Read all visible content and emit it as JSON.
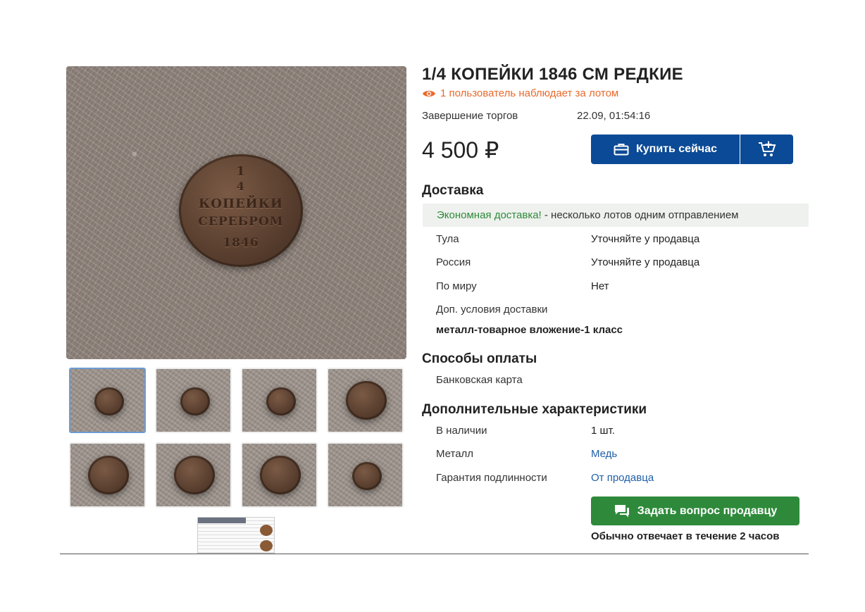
{
  "lot": {
    "title": "1/4 КОПЕЙКИ 1846 СМ РЕДКИЕ",
    "watchers": "1 пользователь наблюдает за лотом",
    "end_label": "Завершение торгов",
    "end_value": "22.09, 01:54:16",
    "price": "4 500 ₽",
    "buy_label": "Купить сейчас"
  },
  "coin_legend": {
    "fraction": "1",
    "denom": "4",
    "line1": "КОПЕЙКИ",
    "line2": "СЕРЕБРОМ",
    "year": "1846"
  },
  "delivery": {
    "heading": "Доставка",
    "econ_highlight": "Экономная доставка!",
    "econ_rest": " - несколько лотов одним отправлением",
    "rows": [
      {
        "label": "Тула",
        "value": "Уточняйте у продавца"
      },
      {
        "label": "Россия",
        "value": "Уточняйте у продавца"
      },
      {
        "label": "По миру",
        "value": "Нет"
      }
    ],
    "extra_label": "Доп. условия доставки",
    "extra_value": "металл-товарное вложение-1 класс"
  },
  "payment": {
    "heading": "Способы оплаты",
    "method": "Банковская карта"
  },
  "characteristics": {
    "heading": "Дополнительные характеристики",
    "rows": [
      {
        "label": "В наличии",
        "value": "1 шт."
      },
      {
        "label": "Металл",
        "value": "Медь"
      },
      {
        "label": "Гарантия подлинности",
        "value": "От продавца"
      }
    ]
  },
  "seller": {
    "ask_label": "Задать вопрос продавцу",
    "reply_note": "Обычно отвечает в течение 2 часов"
  },
  "colors": {
    "primary": "#0b4a96",
    "success": "#2e8a3a",
    "accent": "#e86a2c",
    "link": "#1f5fa8"
  },
  "icons": {
    "watch": "eye-icon",
    "buy": "briefcase-icon",
    "cart": "cart-add-icon",
    "ask": "chat-icon"
  }
}
